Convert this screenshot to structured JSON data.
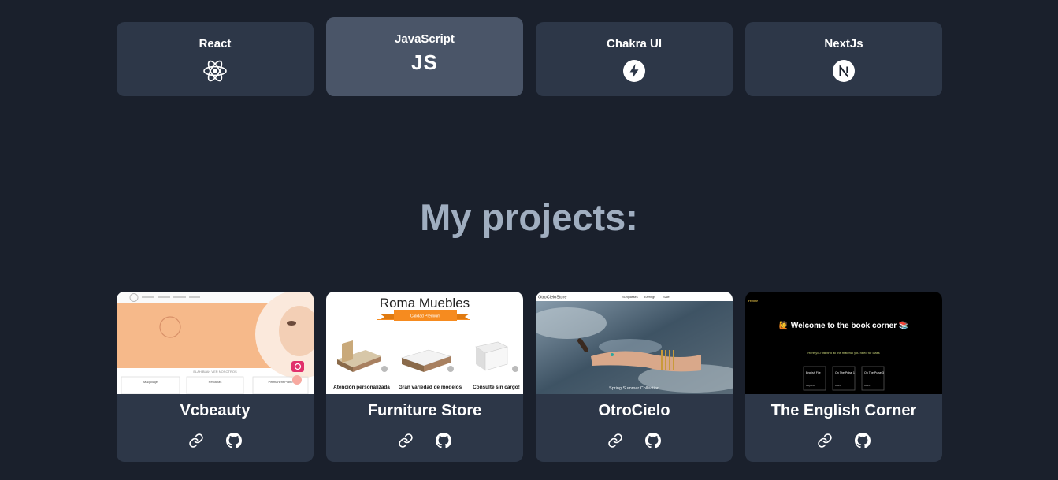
{
  "skills": [
    {
      "label": "React",
      "icon": "react-icon"
    },
    {
      "label": "JavaScript",
      "icon_text": "JS"
    },
    {
      "label": "Chakra UI",
      "icon": "chakra-bolt-icon"
    },
    {
      "label": "NextJs",
      "icon": "nextjs-icon"
    }
  ],
  "heading": "My projects:",
  "projects": [
    {
      "title": "Vcbeauty",
      "screenshot": {
        "caption": "BLAH BLAH VER NOSOTROS",
        "box_labels": [
          "Maquillaje",
          "Pestañas",
          "Permanent Plano"
        ]
      }
    },
    {
      "title": "Furniture Store",
      "screenshot": {
        "brand": "Roma Muebles",
        "ribbon": "Calidad Premium",
        "captions": [
          "Atención personalizada",
          "Gran variedad de modelos",
          "Consulte sin cargo!"
        ]
      }
    },
    {
      "title": "OtroCielo",
      "screenshot": {
        "brand": "OtroCieloStore",
        "nav": [
          "Sunglasses",
          "Earrings",
          "Sale!"
        ],
        "caption": "Spring Summer Collection"
      }
    },
    {
      "title": "The English Corner",
      "screenshot": {
        "nav": "Home",
        "headline": "🙋 Welcome to the book corner 📚",
        "sub": "Here you will find all the material you need for class",
        "cards": [
          {
            "title": "English File",
            "foot": "Beginner"
          },
          {
            "title": "On The Pulse 1",
            "foot": "Basic"
          },
          {
            "title": "On The Pulse 3",
            "foot": "Basic"
          }
        ]
      }
    }
  ],
  "colors": {
    "background": "#1a202c",
    "card": "#2d3748",
    "active_card": "#4a5568",
    "heading": "#a0aec0"
  },
  "icons": {
    "link": "link-icon",
    "github": "github-icon"
  }
}
